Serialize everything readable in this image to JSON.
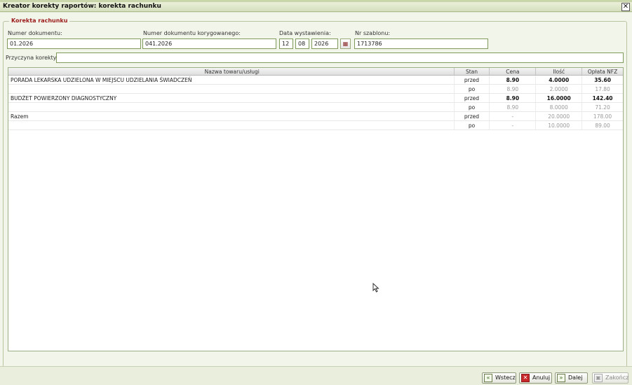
{
  "window": {
    "title": "Kreator korekty raportów: korekta rachunku",
    "close_glyph": "✕"
  },
  "section": {
    "legend": "Korekta rachunku"
  },
  "fields": {
    "numer_dokumentu": {
      "label": "Numer dokumentu:",
      "value": "01.2026"
    },
    "numer_korygowanego": {
      "label": "Numer dokumentu korygowanego:",
      "value": "041.2026"
    },
    "data_wystawienia": {
      "label": "Data wystawienia:",
      "day": "12",
      "month": "08",
      "year": "2026"
    },
    "nr_szablonu": {
      "label": "Nr szablonu:",
      "value": "1713786"
    },
    "przyczyna": {
      "label": "Przyczyna korekty:",
      "value": ""
    }
  },
  "table": {
    "headers": {
      "name": "Nazwa towaru/usługi",
      "stan": "Stan",
      "cena": "Cena",
      "ilosc": "Ilość",
      "oplata": "Opłata NFZ"
    },
    "rows": [
      {
        "name": "PORADA LEKARSKA UDZIELONA W MIEJSCU UDZIELANIA ŚWIADCZEŃ",
        "stan": "przed",
        "cena": "8.90",
        "ilosc": "4.0000",
        "oplata": "35.60",
        "style": "bold"
      },
      {
        "name": "",
        "stan": "po",
        "cena": "8.90",
        "ilosc": "2.0000",
        "oplata": "17.80",
        "style": "muted"
      },
      {
        "name": "BUDŻET POWIERZONY DIAGNOSTYCZNY",
        "stan": "przed",
        "cena": "8.90",
        "ilosc": "16.0000",
        "oplata": "142.40",
        "style": "bold"
      },
      {
        "name": "",
        "stan": "po",
        "cena": "8.90",
        "ilosc": "8.0000",
        "oplata": "71.20",
        "style": "muted"
      },
      {
        "name": "Razem",
        "stan": "przed",
        "cena": "-",
        "ilosc": "20.0000",
        "oplata": "178.00",
        "style": "muted"
      },
      {
        "name": "",
        "stan": "po",
        "cena": "-",
        "ilosc": "10.0000",
        "oplata": "89.00",
        "style": "muted"
      }
    ]
  },
  "buttons": {
    "back": "Wstecz",
    "cancel": "Anuluj",
    "next": "Dalej",
    "finish": "Zakończ"
  }
}
